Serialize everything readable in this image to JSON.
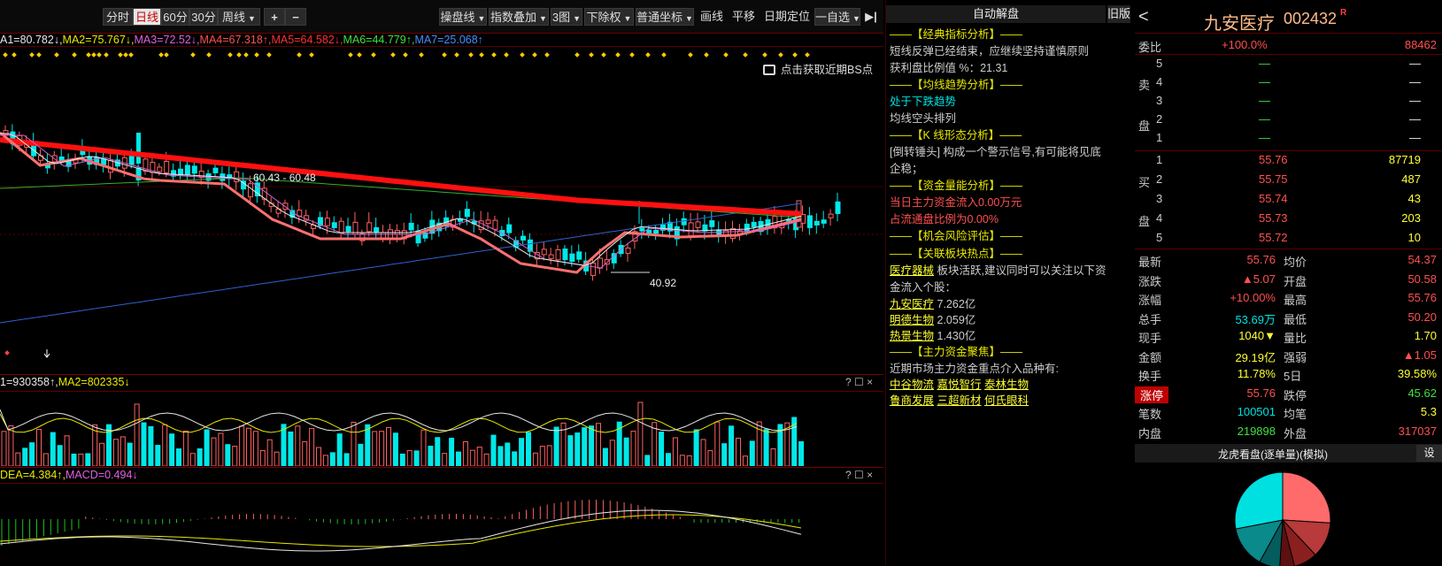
{
  "toolbar": {
    "period_buttons": [
      "分时",
      "日线",
      "60分",
      "30分"
    ],
    "weekly": "周线",
    "plus": "+",
    "minus": "−",
    "menus": [
      "操盘线",
      "指数叠加",
      "3图",
      "下除权",
      "普通坐标"
    ],
    "plain": [
      "画线",
      "平移",
      "日期定位"
    ],
    "watchlist": "一自选",
    "expand": "▶|"
  },
  "main_chart": {
    "legend": [
      {
        "text": "A1=80.782↓",
        "color": "#e8e8e8"
      },
      {
        "text": "MA2=75.767↓",
        "color": "#e8e800"
      },
      {
        "text": "MA3=72.52↓",
        "color": "#e060e0"
      },
      {
        "text": "MA4=67.318↑",
        "color": "#ff5050"
      },
      {
        "text": "MA5=64.582↓",
        "color": "#ff3030"
      },
      {
        "text": "MA6=44.779↑",
        "color": "#40e040"
      },
      {
        "text": "MA7=25.068↑",
        "color": "#4090ff"
      }
    ],
    "bs_hint": "点击获取近期BS点",
    "range_label": "60.43 - 60.48",
    "low_label": "40.92"
  },
  "volume_chart": {
    "legend": [
      {
        "text": "1=930358↑",
        "color": "#e8e8e8"
      },
      {
        "text": "MA2=802335↓",
        "color": "#e8e800"
      }
    ],
    "corner": "? ☐ ×"
  },
  "macd_chart": {
    "legend": [
      {
        "text": "DEA=4.384↑",
        "color": "#e8e800"
      },
      {
        "text": "MACD=0.494↓",
        "color": "#e060e0"
      }
    ],
    "corner": "? ☐ ×"
  },
  "analysis": {
    "title": "自动解盘",
    "old_version": "旧版",
    "lines": [
      {
        "text": "——【经典指标分析】——",
        "cls": "hdr"
      },
      {
        "text": "短线反弹已经结束，应继续坚持谨慎原则",
        "cls": "wht"
      },
      {
        "text": "获利盘比例值 %：21.31",
        "cls": "wht"
      },
      {
        "text": "——【均线趋势分析】——",
        "cls": "hdr"
      },
      {
        "text": "处于下跌趋势",
        "cls": "cyan"
      },
      {
        "text": "均线空头排列",
        "cls": "wht"
      },
      {
        "text": "——【K 线形态分析】——",
        "cls": "hdr"
      },
      {
        "text": "[倒转锤头] 构成一个警示信号,有可能将见底",
        "cls": "wht"
      },
      {
        "text": "企稳；",
        "cls": "wht"
      },
      {
        "text": "——【资金量能分析】——",
        "cls": "hdr"
      },
      {
        "text": "当日主力资金流入0.00万元",
        "cls": "red"
      },
      {
        "text": "占流通盘比例为0.00%",
        "cls": "red"
      },
      {
        "text": "——【机会风险评估】——",
        "cls": "hdr"
      }
    ],
    "hot_header": "——【关联板块热点】——",
    "sector_link": "医疗器械",
    "sector_text": "板块活跃,建议同时可以关注以下资",
    "sector_text2": "金流入个股：",
    "stocks": [
      {
        "name": "九安医疗",
        "amount": "7.262亿"
      },
      {
        "name": "明德生物",
        "amount": "2.059亿"
      },
      {
        "name": "热景生物",
        "amount": "1.430亿"
      }
    ],
    "fund_header": "——【主力资金聚焦】——",
    "fund_text": "近期市场主力资金重点介入品种有:",
    "fund_stocks_1": [
      "中谷物流",
      "嘉悦智行",
      "泰林生物"
    ],
    "fund_stocks_2": [
      "鲁商发展",
      "三超新材",
      "何氏眼科"
    ]
  },
  "quote": {
    "back": "<",
    "name": "九安医疗",
    "code": "002432",
    "tag": "R",
    "weibi_label": "委比",
    "weibi_value": "+100.0%",
    "weicha": "88462",
    "sell_label": [
      "卖",
      "盘"
    ],
    "buy_label": [
      "买",
      "盘"
    ],
    "sells": [
      {
        "lvl": "5",
        "price": "—",
        "vol": "—"
      },
      {
        "lvl": "4",
        "price": "—",
        "vol": "—"
      },
      {
        "lvl": "3",
        "price": "—",
        "vol": "—"
      },
      {
        "lvl": "2",
        "price": "—",
        "vol": "—"
      },
      {
        "lvl": "1",
        "price": "—",
        "vol": "—"
      }
    ],
    "buys": [
      {
        "lvl": "1",
        "price": "55.76",
        "vol": "87719"
      },
      {
        "lvl": "2",
        "price": "55.75",
        "vol": "487"
      },
      {
        "lvl": "3",
        "price": "55.74",
        "vol": "43"
      },
      {
        "lvl": "4",
        "price": "55.73",
        "vol": "203"
      },
      {
        "lvl": "5",
        "price": "55.72",
        "vol": "10"
      }
    ],
    "stats": [
      {
        "l1": "最新",
        "v1": "55.76",
        "c1": "#ff5050",
        "l2": "均价",
        "v2": "54.37",
        "c2": "#ff5050"
      },
      {
        "l1": "涨跌",
        "v1": "▲5.07",
        "c1": "#ff5050",
        "l2": "开盘",
        "v2": "50.58",
        "c2": "#ff5050"
      },
      {
        "l1": "涨幅",
        "v1": "+10.00%",
        "c1": "#ff5050",
        "l2": "最高",
        "v2": "55.76",
        "c2": "#ff5050"
      },
      {
        "l1": "总手",
        "v1": "53.69万",
        "c1": "#00e0e0",
        "l2": "最低",
        "v2": "50.20",
        "c2": "#ff5050"
      },
      {
        "l1": "现手",
        "v1": "1040▼",
        "c1": "#ffff33",
        "l2": "量比",
        "v2": "1.70",
        "c2": "#ffff33"
      },
      {
        "l1": "金额",
        "v1": "29.19亿",
        "c1": "#ffff33",
        "l2": "强弱",
        "v2": "▲1.05",
        "c2": "#ff5050"
      },
      {
        "l1": "换手",
        "v1": "11.78%",
        "c1": "#ffff33",
        "l2": "5日",
        "v2": "39.58%",
        "c2": "#ffff33"
      },
      {
        "l1": "涨停",
        "v1": "55.76",
        "c1": "#ff5050",
        "l2": "跌停",
        "v2": "45.62",
        "c2": "#40e040"
      },
      {
        "l1": "笔数",
        "v1": "100501",
        "c1": "#00e0e0",
        "l2": "均笔",
        "v2": "5.3",
        "c2": "#ffff33"
      },
      {
        "l1": "内盘",
        "v1": "219898",
        "c1": "#40e040",
        "l2": "外盘",
        "v2": "317037",
        "c2": "#ff5050"
      }
    ],
    "dragon_title": "龙虎看盘(逐单量)(模拟)",
    "settings": "设",
    "pie_slices": [
      {
        "value": 0.26,
        "color": "#ff6a6a"
      },
      {
        "value": 0.12,
        "color": "#b83a3a"
      },
      {
        "value": 0.08,
        "color": "#8a1f1f"
      },
      {
        "value": 0.05,
        "color": "#5c1010"
      },
      {
        "value": 0.07,
        "color": "#055c5c"
      },
      {
        "value": 0.14,
        "color": "#0a8a8a"
      },
      {
        "value": 0.28,
        "color": "#00e0e0"
      }
    ]
  }
}
